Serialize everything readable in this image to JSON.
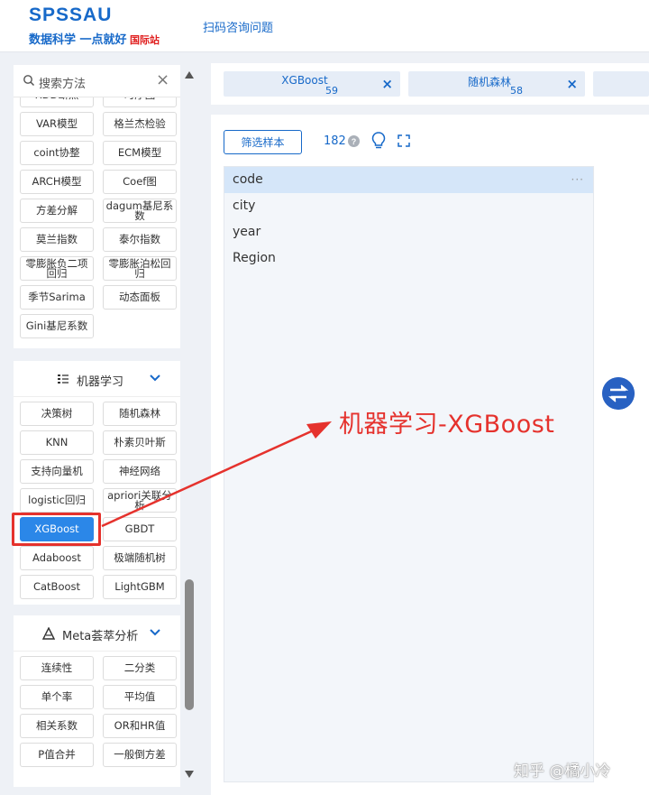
{
  "header": {
    "logo": "SPSSAU",
    "slogan": "数据科学 一点就好",
    "intl": "国际站",
    "link": "扫码咨询问题"
  },
  "search": {
    "placeholder": "搜索方法",
    "clear_icon": "×"
  },
  "method_buttons_top": [
    "RDD断点",
    "时序图",
    "VAR模型",
    "格兰杰检验",
    "coint协整",
    "ECM模型",
    "ARCH模型",
    "Coef图",
    "方差分解",
    "dagum基尼系数",
    "莫兰指数",
    "泰尔指数",
    "零膨胀负二项回归",
    "零膨胀泊松回归",
    "季节Sarima",
    "动态面板",
    "Gini基尼系数"
  ],
  "ml_section": {
    "title": "机器学习",
    "buttons": [
      "决策树",
      "随机森林",
      "KNN",
      "朴素贝叶斯",
      "支持向量机",
      "神经网络",
      "logistic回归",
      "apriori关联分析",
      "XGBoost",
      "GBDT",
      "Adaboost",
      "极端随机树",
      "CatBoost",
      "LightGBM"
    ],
    "active": "XGBoost"
  },
  "meta_section": {
    "title": "Meta荟萃分析",
    "buttons": [
      "连续性",
      "二分类",
      "单个率",
      "平均值",
      "相关系数",
      "OR和HR值",
      "P值合并",
      "一般倒方差"
    ]
  },
  "tabs": [
    {
      "label": "XGBoost",
      "count": "59"
    },
    {
      "label": "随机森林",
      "count": "58"
    }
  ],
  "toolbar": {
    "filter_label": "筛选样本",
    "sample_count": "182"
  },
  "variables": [
    {
      "name": "code",
      "selected": true,
      "more": "···"
    },
    {
      "name": "city",
      "selected": false
    },
    {
      "name": "year",
      "selected": false
    },
    {
      "name": "Region",
      "selected": false
    }
  ],
  "annotation": "机器学习-XGBoost",
  "watermark": "知乎 @橘小冷",
  "colors": {
    "brand": "#1769c9",
    "active_button": "#2b87e8",
    "annotation_red": "#e5322d"
  }
}
